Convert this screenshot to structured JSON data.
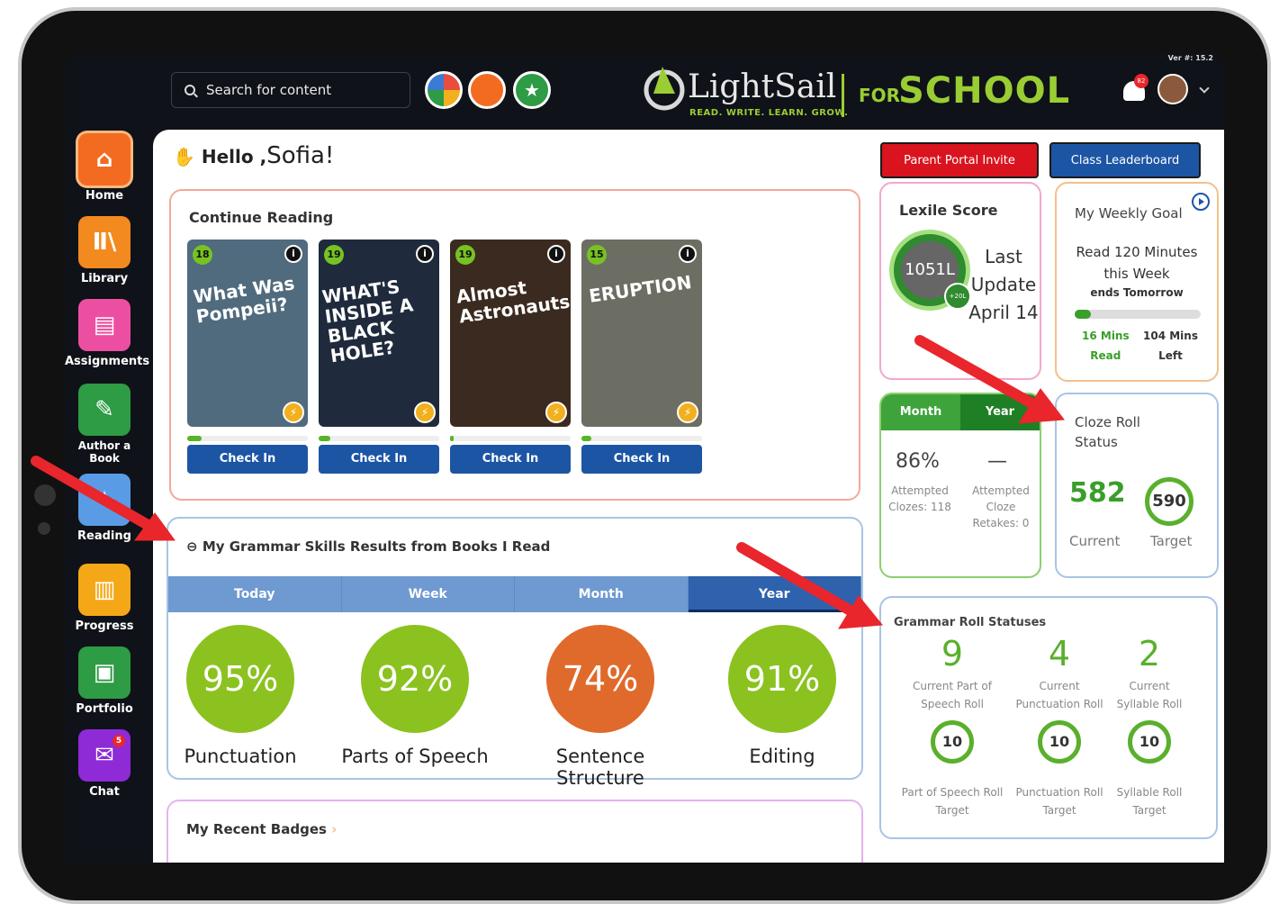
{
  "topbar": {
    "search_placeholder": "Search for content",
    "version": "Ver #: 15.2",
    "notifications": "82"
  },
  "brand": {
    "name": "LightSail",
    "tagline": "READ. WRITE. LEARN. GROW.",
    "for": "FOR",
    "school": "SCHOOL"
  },
  "sidebar": {
    "items": [
      {
        "label": "Home",
        "icon": "home-icon",
        "color": "#f36b21"
      },
      {
        "label": "Library",
        "icon": "library-icon",
        "color": "#f38a1f"
      },
      {
        "label": "Assignments",
        "icon": "clipboard-icon",
        "color": "#ec4fa1"
      },
      {
        "label": "Author a Book",
        "icon": "pencil-icon",
        "color": "#2e9b45"
      },
      {
        "label": "Reading",
        "icon": "reading-icon",
        "color": "#5a9be5"
      },
      {
        "label": "Progress",
        "icon": "chart-icon",
        "color": "#f5a817"
      },
      {
        "label": "Portfolio",
        "icon": "portfolio-icon",
        "color": "#2e9b45"
      },
      {
        "label": "Chat",
        "icon": "chat-icon",
        "color": "#8e2ad6",
        "badge": "5"
      }
    ]
  },
  "greeting": {
    "hello": "Hello ,",
    "name": "Sofia!"
  },
  "continue_reading": {
    "title": "Continue Reading",
    "check_in": "Check In",
    "books": [
      {
        "level": "18",
        "title": "What Was Pompeii?",
        "progress": 0.12,
        "bg": "#4f6b7d"
      },
      {
        "level": "19",
        "title": "WHAT'S INSIDE A BLACK HOLE?",
        "progress": 0.1,
        "bg": "#1f2a3c"
      },
      {
        "level": "19",
        "title": "Almost Astronauts",
        "progress": 0.03,
        "bg": "#3b2a1f"
      },
      {
        "level": "15",
        "title": "ERUPTION",
        "progress": 0.08,
        "bg": "#6d6e63"
      }
    ]
  },
  "grammar": {
    "title": "My Grammar Skills Results from Books I Read",
    "tabs": [
      "Today",
      "Week",
      "Month",
      "Year"
    ],
    "active_tab": "Year",
    "results": [
      {
        "value": "95%",
        "label": "Punctuation",
        "color": "#8bc21f"
      },
      {
        "value": "92%",
        "label": "Parts of Speech",
        "color": "#8bc21f"
      },
      {
        "value": "74%",
        "label": "Sentence Structure",
        "color": "#e06a2b"
      },
      {
        "value": "91%",
        "label": "Editing",
        "color": "#8bc21f"
      }
    ]
  },
  "badges": {
    "title": "My Recent Badges"
  },
  "buttons": {
    "parent_portal": "Parent Portal Invite",
    "leaderboard": "Class Leaderboard"
  },
  "lexile": {
    "title": "Lexile Score",
    "score": "1051L",
    "change": "+20L",
    "last_update": [
      "Last",
      "Update",
      "April 14"
    ]
  },
  "weekly_goal": {
    "title": "My Weekly Goal",
    "goal": [
      "Read 120 Minutes",
      "this Week"
    ],
    "ends": "ends Tomorrow",
    "progress": 0.13,
    "read": [
      "16 Mins",
      "Read"
    ],
    "left": [
      "104 Mins",
      "Left"
    ]
  },
  "month_tabs": {
    "tabs": [
      "Month",
      "Year"
    ]
  },
  "cloze_stats": {
    "v1": "86%",
    "l1": [
      "Attempted",
      "Clozes: 118"
    ],
    "v2": "—",
    "l2": [
      "Attempted",
      "Cloze",
      "Retakes: 0"
    ]
  },
  "cloze_roll": {
    "title": [
      "Cloze Roll",
      "Status"
    ],
    "current": "582",
    "target": "590",
    "current_label": "Current",
    "target_label": "Target"
  },
  "grammar_roll": {
    "title": "Grammar Roll Statuses",
    "items": [
      {
        "current": "9",
        "current_label": [
          "Current Part of",
          "Speech Roll"
        ],
        "target": "10",
        "target_label": [
          "Part of Speech Roll",
          "Target"
        ]
      },
      {
        "current": "4",
        "current_label": [
          "Current",
          "Punctuation Roll"
        ],
        "target": "10",
        "target_label": [
          "Punctuation Roll",
          "Target"
        ]
      },
      {
        "current": "2",
        "current_label": [
          "Current",
          "Syllable Roll"
        ],
        "target": "10",
        "target_label": [
          "Syllable Roll",
          "Target"
        ]
      }
    ]
  }
}
